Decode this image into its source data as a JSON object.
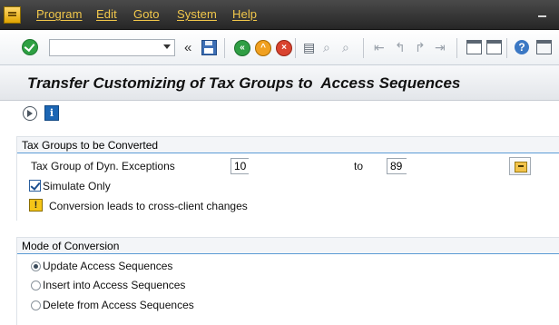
{
  "menubar": {
    "items": [
      "Program",
      "Edit",
      "Goto",
      "System",
      "Help"
    ]
  },
  "toolbar": {
    "command_field_value": "",
    "expand_glyph": "«",
    "icons": [
      "ok-icon",
      "command-dropdown-icon",
      "save-icon",
      "back-icon",
      "exit-icon",
      "cancel-icon",
      "print-icon",
      "find-icon",
      "find-next-icon",
      "first-page-icon",
      "previous-page-icon",
      "next-page-icon",
      "last-page-icon",
      "new-session-icon",
      "shortcut-icon",
      "help-icon",
      "layout-icon"
    ]
  },
  "title": {
    "text": "Transfer Customizing of Tax Groups to  Access Sequences"
  },
  "app_toolbar": {
    "icons": [
      "execute-icon",
      "info-icon"
    ]
  },
  "group1": {
    "title": "Tax Groups to be Converted",
    "field_label": "Tax Group of Dyn. Exceptions",
    "from_value": "10",
    "to_label": "to",
    "to_value": "89",
    "simulate_label": "Simulate Only",
    "simulate_checked": true,
    "warning_text": "Conversion leads to cross-client changes"
  },
  "group2": {
    "title": "Mode of Conversion",
    "options": [
      {
        "label": "Update Access Sequences",
        "selected": true
      },
      {
        "label": "Insert into Access Sequences",
        "selected": false
      },
      {
        "label": "Delete from Access Sequences",
        "selected": false
      }
    ]
  },
  "colors": {
    "menubar_bg": "#2e2e2e",
    "menu_text": "#f2c84b",
    "accent_line": "#5b9bd5",
    "ok_green": "#2ea043"
  }
}
